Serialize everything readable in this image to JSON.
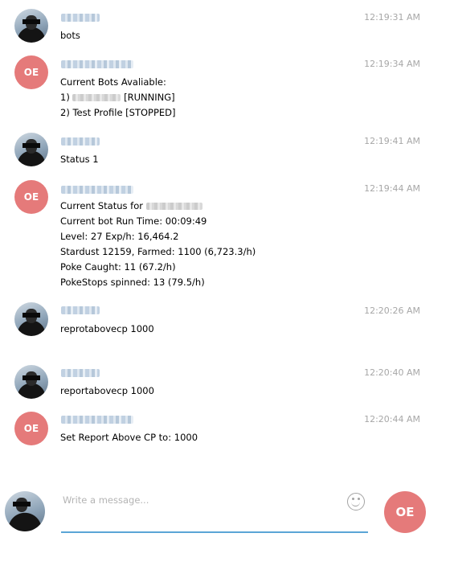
{
  "messages": [
    {
      "sender_type": "user",
      "time": "12:19:31 AM",
      "lines": [
        "bots"
      ]
    },
    {
      "sender_type": "bot",
      "avatar_initials": "OE",
      "time": "12:19:34 AM",
      "lines": [
        "Current Bots Avaliable:",
        "1) ",
        "[RUNNING]",
        "2) Test Profile [STOPPED]"
      ]
    },
    {
      "sender_type": "user",
      "time": "12:19:41 AM",
      "lines": [
        "Status 1"
      ]
    },
    {
      "sender_type": "bot",
      "avatar_initials": "OE",
      "time": "12:19:44 AM",
      "lines": [
        "Current Status for ",
        "Current bot Run Time: 00:09:49",
        "Level: 27 Exp/h: 16,464.2",
        "Stardust 12159, Farmed: 1100 (6,723.3/h)",
        "Poke Caught: 11 (67.2/h)",
        "PokeStops spinned: 13 (79.5/h)"
      ]
    },
    {
      "sender_type": "user",
      "time": "12:20:26 AM",
      "lines": [
        "reprotabovecp 1000"
      ]
    },
    {
      "sender_type": "user",
      "time": "12:20:40 AM",
      "lines": [
        "reportabovecp 1000"
      ]
    },
    {
      "sender_type": "bot",
      "avatar_initials": "OE",
      "time": "12:20:44 AM",
      "lines": [
        "Set Report Above CP to: 1000"
      ]
    }
  ],
  "composer": {
    "placeholder": "Write a message...",
    "emoji_icon": "smiley-icon",
    "send_avatar_initials": "OE"
  },
  "colors": {
    "bot_avatar": "#e57a7a",
    "input_underline": "#5aa5d6",
    "timestamp": "#a7a7a7"
  }
}
